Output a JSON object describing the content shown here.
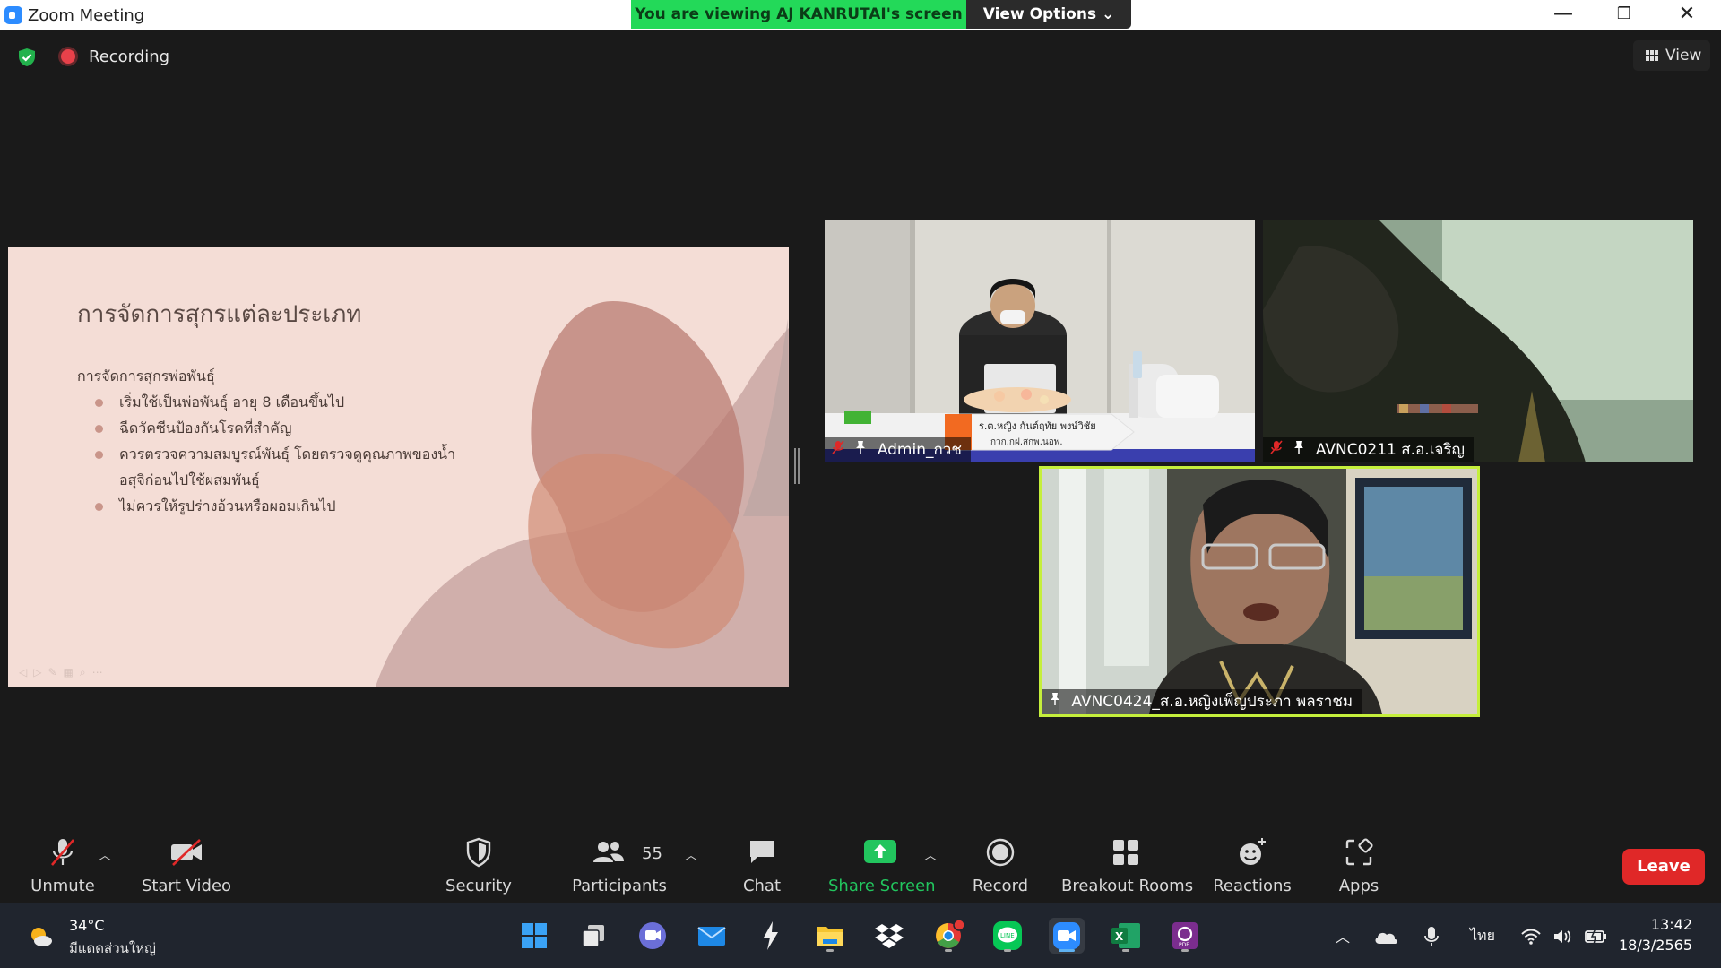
{
  "window": {
    "title": "Zoom Meeting",
    "viewing_banner": "You are viewing AJ KANRUTAI's screen",
    "view_options_label": "View Options",
    "recording_label": "Recording",
    "view_label": "View"
  },
  "slide": {
    "title": "การจัดการสุกรแต่ละประเภท",
    "subtitle": "การจัดการสุกรพ่อพันธุ์",
    "bullets": [
      "เริ่มใช้เป็นพ่อพันธุ์ อายุ 8 เดือนขึ้นไป",
      "ฉีดวัคซีนป้องกันโรคที่สำคัญ",
      "ควรตรวจความสมบูรณ์พันธุ์ โดยตรวจดูคุณภาพของน้ำ อสุจิก่อนไปใช้ผสมพันธุ์",
      "ไม่ควรให้รูปร่างอ้วนหรือผอมเกินไป"
    ]
  },
  "participants": [
    {
      "name": "Admin_กวช",
      "muted": true,
      "banner_line1": "ร.ต.หญิง กันต์ฤทัย พงษ์วิชัย",
      "banner_line2": "กวก.กฝ.สกพ.นอพ."
    },
    {
      "name": "AVNC0211 ส.อ.เจริญ",
      "muted": true
    },
    {
      "name": "AVNC0424_ส.อ.หญิงเพ็ญประภา พลราชม",
      "muted": false,
      "active_speaker": true
    }
  ],
  "toolbar": {
    "unmute": "Unmute",
    "start_video": "Start Video",
    "security": "Security",
    "participants": "Participants",
    "participants_count": "55",
    "chat": "Chat",
    "share_screen": "Share Screen",
    "record": "Record",
    "breakout_rooms": "Breakout Rooms",
    "reactions": "Reactions",
    "apps": "Apps",
    "leave": "Leave"
  },
  "taskbar": {
    "weather_temp": "34°C",
    "weather_desc": "มีแดดส่วนใหญ่",
    "language": "ไทย",
    "time": "13:42",
    "date": "18/3/2565"
  },
  "colors": {
    "banner_green": "#23d959",
    "active_speaker_border": "#c5ef3c",
    "leave_red": "#e02828",
    "share_green": "#22c55e"
  }
}
